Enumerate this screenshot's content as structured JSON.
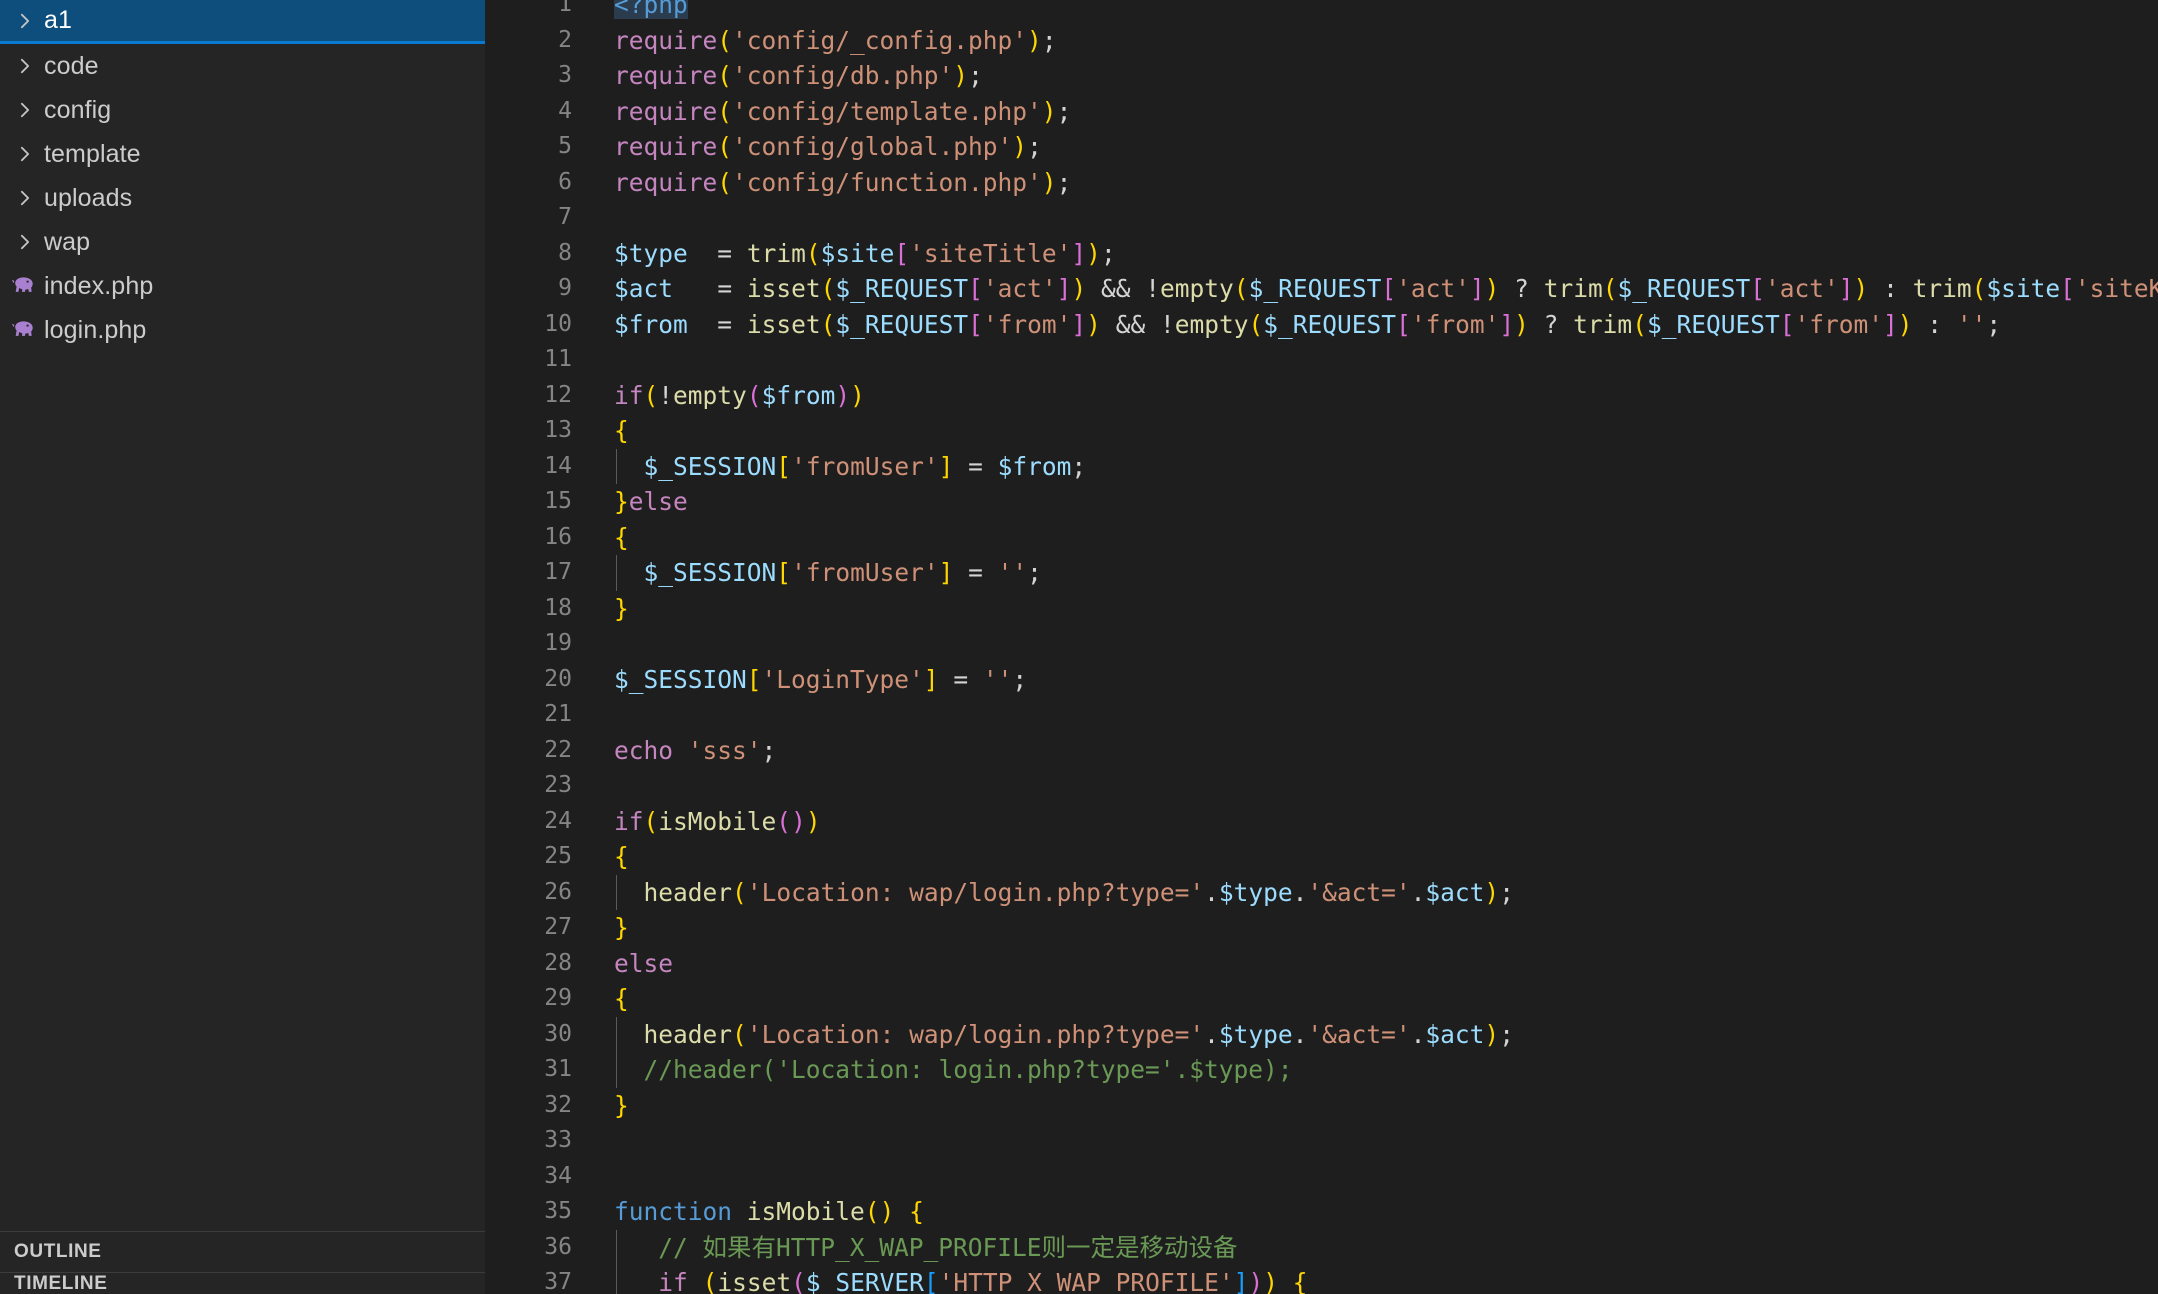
{
  "sidebar": {
    "tree": [
      {
        "label": "a1",
        "type": "folder",
        "expanded": false,
        "selected": true
      },
      {
        "label": "code",
        "type": "folder",
        "expanded": false,
        "selected": false
      },
      {
        "label": "config",
        "type": "folder",
        "expanded": false,
        "selected": false
      },
      {
        "label": "template",
        "type": "folder",
        "expanded": false,
        "selected": false
      },
      {
        "label": "uploads",
        "type": "folder",
        "expanded": false,
        "selected": false
      },
      {
        "label": "wap",
        "type": "folder",
        "expanded": false,
        "selected": false
      },
      {
        "label": "index.php",
        "type": "php-file",
        "expanded": false,
        "selected": false
      },
      {
        "label": "login.php",
        "type": "php-file",
        "expanded": false,
        "selected": false
      }
    ],
    "panes": {
      "outline_label": "OUTLINE",
      "timeline_label": "TIMELINE"
    },
    "icons": {
      "chevron_right": "chevron-right-icon",
      "php_file": "php-elephant-icon"
    }
  },
  "editor": {
    "language": "php",
    "first_visible_line": 1,
    "last_visible_line": 37,
    "current_line": 1,
    "lines": [
      {
        "n": 1,
        "text": "<?php"
      },
      {
        "n": 2,
        "text": "require('config/_config.php');"
      },
      {
        "n": 3,
        "text": "require('config/db.php');"
      },
      {
        "n": 4,
        "text": "require('config/template.php');"
      },
      {
        "n": 5,
        "text": "require('config/global.php');"
      },
      {
        "n": 6,
        "text": "require('config/function.php');"
      },
      {
        "n": 7,
        "text": ""
      },
      {
        "n": 8,
        "text": "$type  = trim($site['siteTitle']);"
      },
      {
        "n": 9,
        "text": "$act   = isset($_REQUEST['act']) && !empty($_REQUEST['act']) ? trim($_REQUEST['act']) : trim($site['siteKeyw"
      },
      {
        "n": 10,
        "text": "$from  = isset($_REQUEST['from']) && !empty($_REQUEST['from']) ? trim($_REQUEST['from']) : '';"
      },
      {
        "n": 11,
        "text": ""
      },
      {
        "n": 12,
        "text": "if(!empty($from))"
      },
      {
        "n": 13,
        "text": "{"
      },
      {
        "n": 14,
        "text": "  $_SESSION['fromUser'] = $from;"
      },
      {
        "n": 15,
        "text": "}else"
      },
      {
        "n": 16,
        "text": "{"
      },
      {
        "n": 17,
        "text": "  $_SESSION['fromUser'] = '';"
      },
      {
        "n": 18,
        "text": "}"
      },
      {
        "n": 19,
        "text": ""
      },
      {
        "n": 20,
        "text": "$_SESSION['LoginType'] = '';"
      },
      {
        "n": 21,
        "text": ""
      },
      {
        "n": 22,
        "text": "echo 'sss';"
      },
      {
        "n": 23,
        "text": ""
      },
      {
        "n": 24,
        "text": "if(isMobile())"
      },
      {
        "n": 25,
        "text": "{"
      },
      {
        "n": 26,
        "text": "  header('Location: wap/login.php?type='.$type.'&act='.$act);"
      },
      {
        "n": 27,
        "text": "}"
      },
      {
        "n": 28,
        "text": "else"
      },
      {
        "n": 29,
        "text": "{"
      },
      {
        "n": 30,
        "text": "  header('Location: wap/login.php?type='.$type.'&act='.$act);"
      },
      {
        "n": 31,
        "text": "  //header('Location: login.php?type='.$type);"
      },
      {
        "n": 32,
        "text": "}"
      },
      {
        "n": 33,
        "text": ""
      },
      {
        "n": 34,
        "text": ""
      },
      {
        "n": 35,
        "text": "function isMobile() {"
      },
      {
        "n": 36,
        "text": "   // 如果有HTTP_X_WAP_PROFILE则一定是移动设备"
      },
      {
        "n": 37,
        "text": "   if (isset($_SERVER['HTTP_X_WAP_PROFILE'])) {"
      }
    ]
  },
  "colors": {
    "editor_background": "#1e1e1e",
    "sidebar_background": "#252526",
    "selection_background": "#0e4e7c",
    "selection_border": "#0a7ad1",
    "line_number": "#858585",
    "foreground": "#cccccc",
    "keyword": "#c586c0",
    "string": "#ce9178",
    "variable": "#9cdcfe",
    "function": "#dcdcaa",
    "comment": "#6a9955",
    "bracket_yellow": "#ffd700",
    "bracket_magenta": "#da70d6",
    "bracket_blue": "#179fff",
    "php_icon": "#a980cf"
  }
}
